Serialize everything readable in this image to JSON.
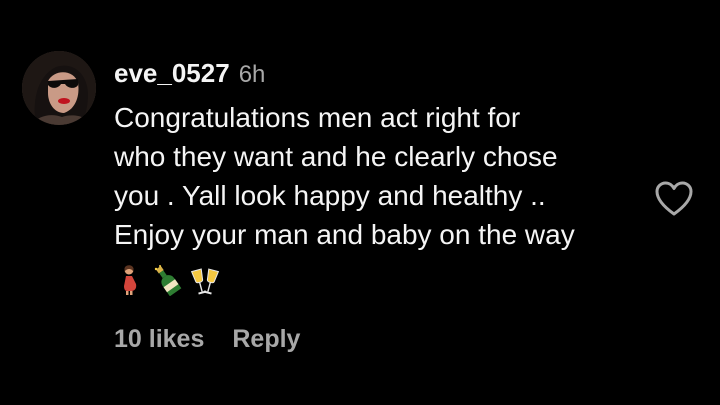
{
  "comment": {
    "username": "eve_0527",
    "timestamp": "6h",
    "text_lines": [
      "Congratulations men act right for",
      "who they want and he clearly chose",
      "you . Yall look happy and healthy ..",
      "Enjoy your man and baby on the way"
    ],
    "emojis": [
      "pregnant-woman-emoji",
      "champagne-bottle-emoji",
      "clinking-glasses-emoji"
    ],
    "likes_label": "10 likes",
    "reply_label": "Reply"
  },
  "icons": {
    "like": "heart-outline-icon",
    "avatar": "profile-photo"
  },
  "colors": {
    "background": "#000000",
    "primary_text": "#f5f5f5",
    "secondary_text": "#a8a8a8"
  }
}
